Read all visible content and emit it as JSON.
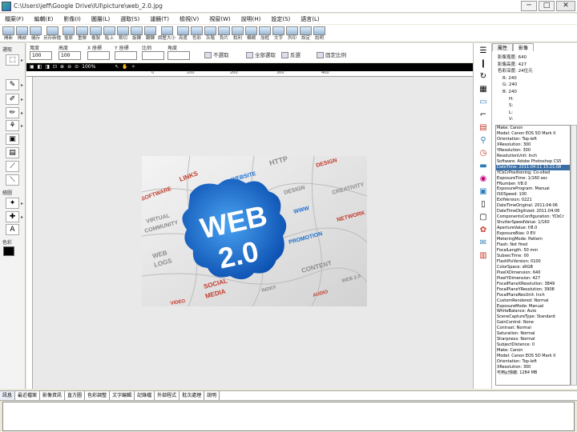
{
  "title": "C:\\Users\\jeff\\Google Drive\\IUI\\picture\\web_2.0.jpg",
  "window_buttons": {
    "minimize": "─",
    "maximize": "□",
    "close": "✕"
  },
  "menu": [
    "檔案(F)",
    "編輯(E)",
    "影像(I)",
    "圖層(L)",
    "選取(S)",
    "濾鏡(T)",
    "檢視(V)",
    "視窗(W)",
    "說明(H)",
    "設定(S)",
    "語言(L)"
  ],
  "toolbar": [
    "開新",
    "開啟",
    "儲存",
    "另存新檔",
    "復原",
    "重做",
    "複製",
    "貼上",
    "裁切",
    "旋轉",
    "翻轉",
    "調整大小",
    "亮度",
    "色彩",
    "灰階",
    "負片",
    "銳利",
    "模糊",
    "加框",
    "文字",
    "列印",
    "設定",
    "說明"
  ],
  "left_panel": {
    "group1": "選取",
    "group2": "繪圖",
    "group3": "色彩"
  },
  "options": {
    "fields": [
      {
        "label": "寬度",
        "value": "100"
      },
      {
        "label": "高度",
        "value": "100"
      },
      {
        "label": "X 座標",
        "value": ""
      },
      {
        "label": "Y 座標",
        "value": ""
      },
      {
        "label": "比例",
        "value": ""
      },
      {
        "label": "角度",
        "value": ""
      }
    ],
    "actions": [
      "不選取",
      "全部選取",
      "反選",
      "固定比例"
    ]
  },
  "image_bar": {
    "zoom": "100%",
    "pos1": "0",
    "pos2": "100",
    "pos3": "200",
    "pos4": "300",
    "pos5": "400"
  },
  "photo": {
    "main1": "WEB",
    "main2": "2.0",
    "words": [
      "HTTP",
      "DESIGN",
      "LINKS",
      "WEBSITE",
      "CREATIVITY",
      "SOFTWARE",
      "DESIGN",
      "WWW",
      "NETWORK",
      "VIRTUAL",
      "COMMUNITY",
      "PROMOTION",
      "WEB",
      "LOGS",
      "CONTENT",
      "WEB 2.0",
      "SOCIAL",
      "MEDIA",
      "INDEX",
      "AUDIO",
      "VIDEO"
    ],
    "colors": {
      "blue": "#1a6fd1",
      "red": "#c23a2b",
      "gray": "#8b8b8b"
    }
  },
  "panel": {
    "tabs": [
      "屬性",
      "影像"
    ],
    "info": [
      "影像寬度: 640",
      "影像高度: 427",
      "色彩深度: 24位元",
      "R: 240",
      "G: 240",
      "B: 240",
      "H:",
      "S:",
      "L:",
      "V:"
    ],
    "exif": [
      "Make: Canon",
      "Model: Canon EOS 5D Mark II",
      "Orientation: Top-left",
      "XResolution: 300",
      "YResolution: 300",
      "ResolutionUnit: Inch",
      "Software: Adobe Photoshop CS5",
      "DateTime: 2011:04:11 15:21:08",
      "YCbCrPositioning: Co-sited",
      "ExposureTime: 1/160 sec",
      "FNumber: f/8.0",
      "ExposureProgram: Manual",
      "ISOSpeed: 100",
      "ExifVersion: 0221",
      "DateTimeOriginal: 2011:04:06",
      "DateTimeDigitized: 2011:04:06",
      "ComponentsConfiguration: YCbCr",
      "ShutterSpeedValue: 1/160",
      "ApertureValue: f/8.0",
      "ExposureBias: 0 EV",
      "MeteringMode: Pattern",
      "Flash: Not fired",
      "FocalLength: 50 mm",
      "SubsecTime: 00",
      "FlashPixVersion: 0100",
      "ColorSpace: sRGB",
      "PixelXDimension: 640",
      "PixelYDimension: 427",
      "FocalPlaneXResolution: 3849",
      "FocalPlaneYResolution: 3908",
      "FocalPlaneResUnit: Inch",
      "CustomRendered: Normal",
      "ExposureMode: Manual",
      "WhiteBalance: Auto",
      "SceneCaptureType: Standard",
      "GainControl: None",
      "Contrast: Normal",
      "Saturation: Normal",
      "Sharpness: Normal",
      "SubjectDistance: 0",
      "Make: Canon",
      "Model: Canon EOS 5D Mark II",
      "Orientation: Top-left",
      "XResolution: 300",
      "可用記憶體: 1284 MB"
    ],
    "selected_index": 7
  },
  "bottom_tabs": [
    "訊息",
    "最近檔案",
    "影像資訊",
    "直方圖",
    "色彩調整",
    "文字編輯",
    "記錄檔",
    "外部程式",
    "批次處理",
    "說明"
  ],
  "colors": {
    "selection": "#3a6ea5",
    "canvas_bg": "#e9e9e9"
  }
}
